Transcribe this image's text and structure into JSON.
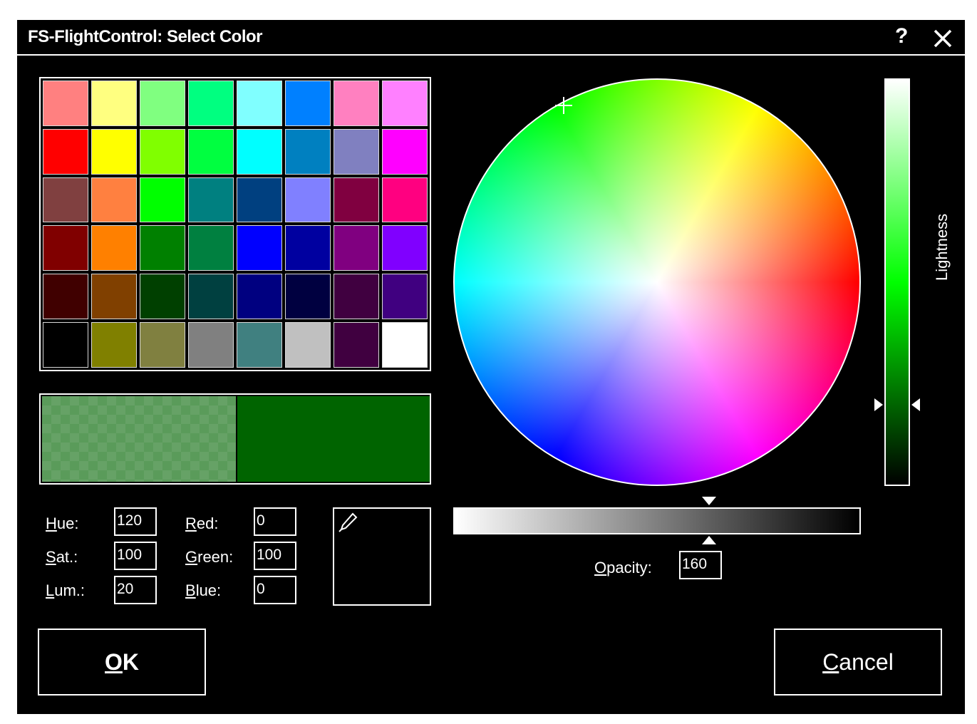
{
  "window": {
    "title": "FS-FlightControl: Select Color",
    "help_label": "?"
  },
  "swatches": [
    "#ff8080",
    "#ffff80",
    "#80ff80",
    "#00ff80",
    "#80ffff",
    "#0080ff",
    "#ff80c0",
    "#ff80ff",
    "#ff0000",
    "#ffff00",
    "#80ff00",
    "#00ff40",
    "#00ffff",
    "#0080c0",
    "#8080c0",
    "#ff00ff",
    "#804040",
    "#ff8040",
    "#00ff00",
    "#008080",
    "#004080",
    "#8080ff",
    "#800040",
    "#ff0080",
    "#800000",
    "#ff8000",
    "#008000",
    "#008040",
    "#0000ff",
    "#0000a0",
    "#800080",
    "#8000ff",
    "#400000",
    "#804000",
    "#004000",
    "#004040",
    "#000080",
    "#000040",
    "#400040",
    "#400080",
    "#000000",
    "#808000",
    "#808040",
    "#808080",
    "#408080",
    "#c0c0c0",
    "#400040",
    "#ffffff"
  ],
  "preview": {
    "old_color": "#5a9b5a",
    "new_color": "#006400"
  },
  "fields": {
    "hue": {
      "label_prefix": "H",
      "label_rest": "ue:",
      "value": "120"
    },
    "sat": {
      "label_prefix": "S",
      "label_rest": "at.:",
      "value": "100"
    },
    "lum": {
      "label_prefix": "L",
      "label_rest": "um.:",
      "value": "20"
    },
    "red": {
      "label_prefix": "R",
      "label_rest": "ed:",
      "value": "0"
    },
    "green": {
      "label_prefix": "G",
      "label_rest": "reen:",
      "value": "100"
    },
    "blue": {
      "label_prefix": "B",
      "label_rest": "lue:",
      "value": "0"
    }
  },
  "lightness": {
    "label": "Lightness",
    "level_fraction": 0.2
  },
  "opacity": {
    "label_prefix": "O",
    "label_rest": "pacity:",
    "value": "160"
  },
  "buttons": {
    "ok": {
      "label_prefix": "O",
      "label_rest": "K"
    },
    "cancel": {
      "label_prefix": "C",
      "label_rest": "ancel"
    }
  },
  "icons": {
    "help": "help-icon",
    "close": "close-icon",
    "eyedropper": "eyedropper-icon"
  }
}
